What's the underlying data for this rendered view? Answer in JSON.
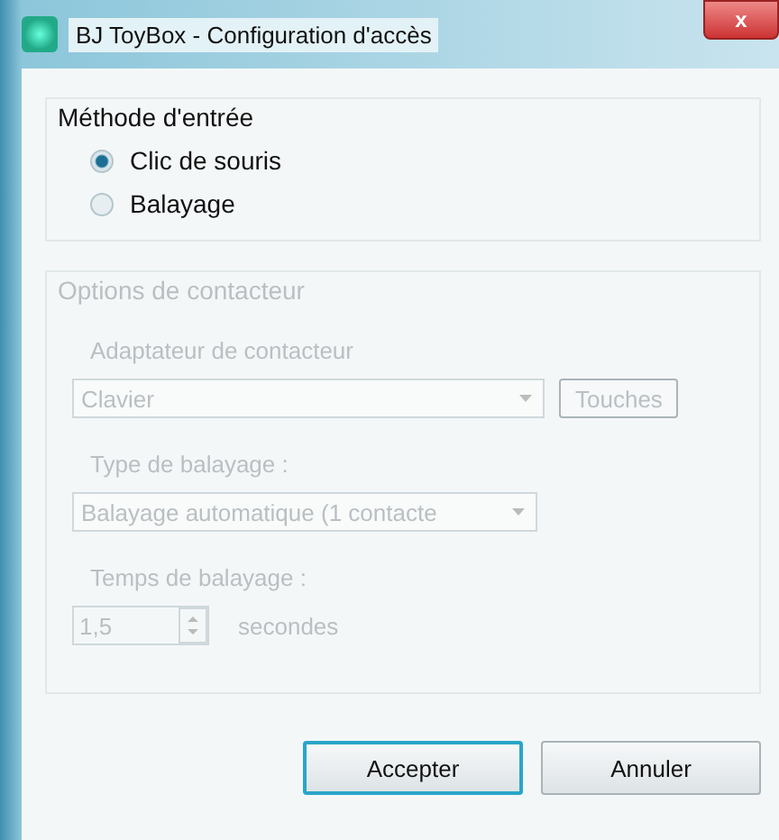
{
  "window": {
    "title": "BJ ToyBox - Configuration d'accès",
    "close": "x"
  },
  "input_method": {
    "title": "Méthode d'entrée",
    "options": [
      {
        "label": "Clic de souris",
        "selected": true
      },
      {
        "label": "Balayage",
        "selected": false
      }
    ]
  },
  "switch_options": {
    "title": "Options de contacteur",
    "disabled": true,
    "adapter": {
      "label": "Adaptateur de contacteur",
      "value": "Clavier",
      "button": "Touches"
    },
    "scan_type": {
      "label": "Type de balayage :",
      "value": "Balayage automatique (1 contacte"
    },
    "scan_time": {
      "label": "Temps de balayage :",
      "value": "1,5",
      "unit": "secondes"
    }
  },
  "buttons": [
    {
      "label": "Accepter",
      "default": true
    },
    {
      "label": "Annuler",
      "default": false
    }
  ]
}
